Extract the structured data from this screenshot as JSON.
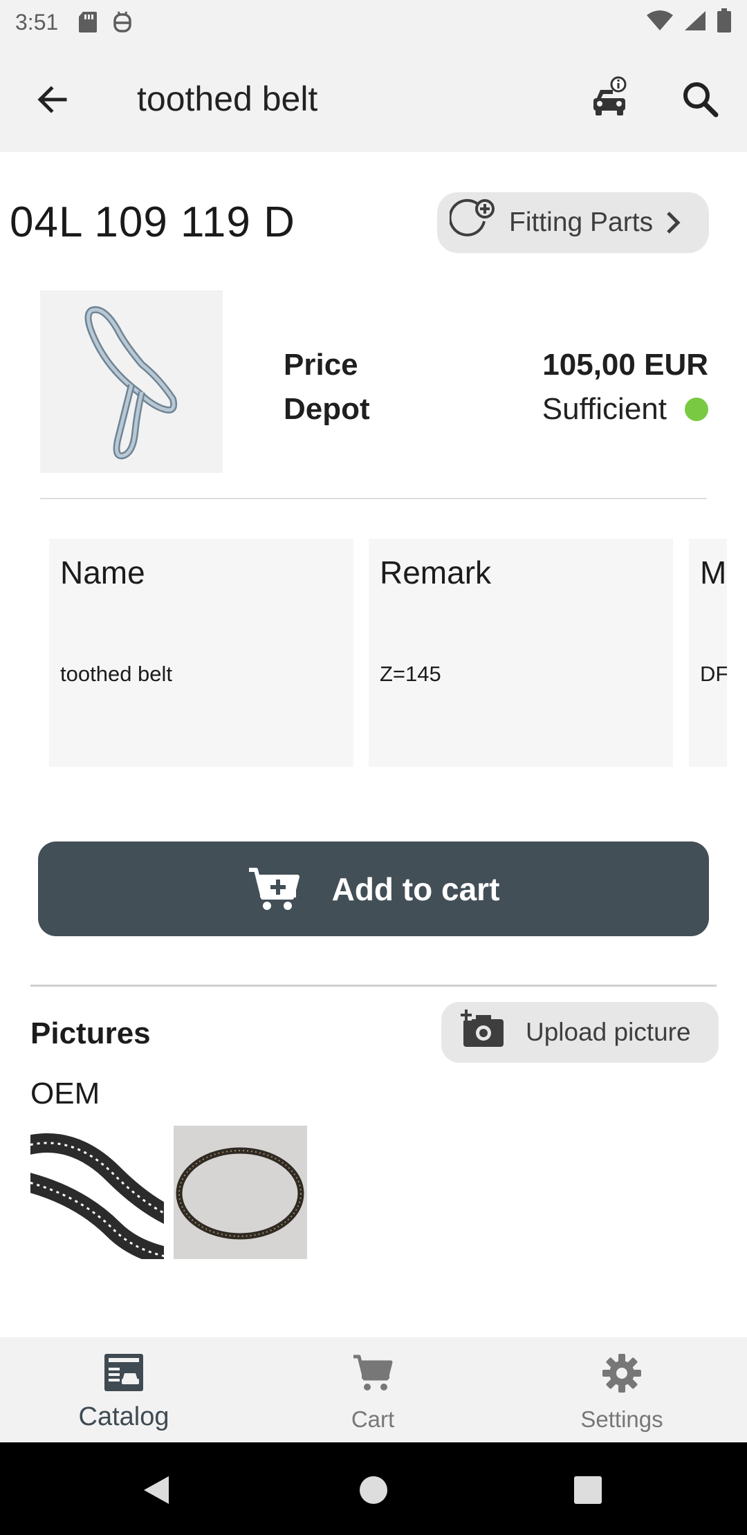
{
  "status": {
    "time": "3:51"
  },
  "appbar": {
    "title": "toothed belt"
  },
  "part": {
    "number": "04L 109 119 D",
    "fitting_label": "Fitting Parts",
    "price_label": "Price",
    "depot_label": "Depot",
    "price_value": "105,00 EUR",
    "depot_value": "Sufficient",
    "availability_color": "#7ac943"
  },
  "cards": [
    {
      "head": "Name",
      "value": "toothed belt"
    },
    {
      "head": "Remark",
      "value": "Z=145"
    },
    {
      "head": "M",
      "value": "DF"
    }
  ],
  "actions": {
    "add_to_cart": "Add to cart",
    "upload_picture": "Upload picture"
  },
  "pictures": {
    "title": "Pictures",
    "group": "OEM"
  },
  "nav": {
    "items": [
      {
        "label": "Catalog",
        "icon": "catalog-icon",
        "active": true
      },
      {
        "label": "Cart",
        "icon": "cart-icon",
        "active": false
      },
      {
        "label": "Settings",
        "icon": "gear-icon",
        "active": false
      }
    ]
  },
  "colors": {
    "primary_button": "#434f57",
    "available": "#7ac943"
  }
}
